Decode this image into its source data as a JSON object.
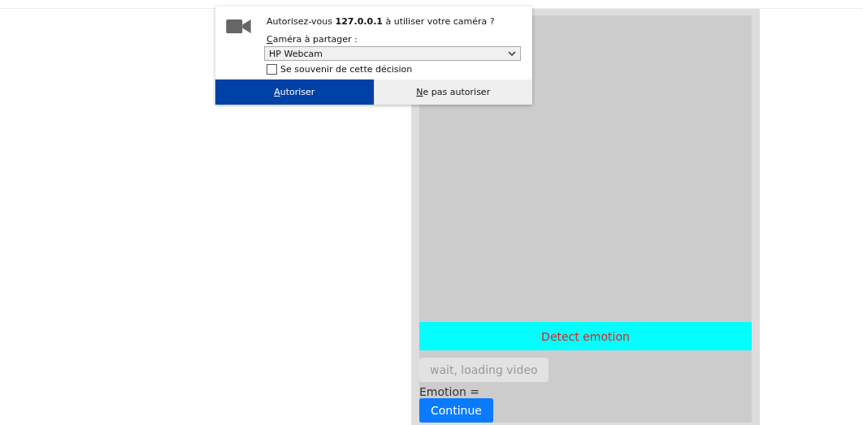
{
  "permission_prompt": {
    "message": "Autorisez-vous **127.0.0.1** à utiliser votre caméra ?",
    "device_label": "Caméra à partager :",
    "device": "HP Webcam",
    "remember": {
      "label": "Se souvenir de cette décision",
      "checked": false
    },
    "buttons": [
      {
        "label": "Autoriser",
        "kind": "primary"
      },
      {
        "label": "Ne pas autoriser",
        "kind": "secondary"
      }
    ]
  },
  "app": {
    "detect_button": "Detect emotion",
    "loading_button": {
      "label": "wait, loading video",
      "disabled": true
    },
    "emotion_label": "Emotion =",
    "continue_button": "Continue"
  }
}
